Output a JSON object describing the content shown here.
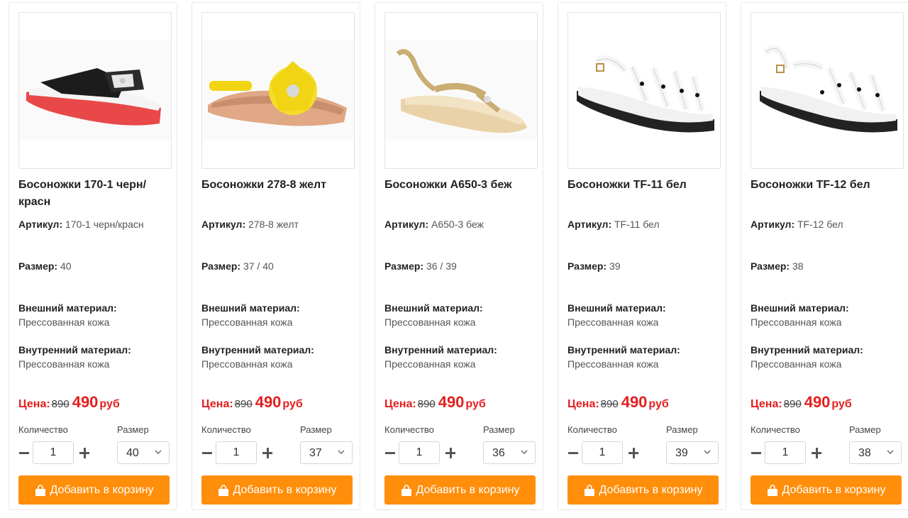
{
  "labels": {
    "article": "Артикул:",
    "size": "Размер:",
    "outer_material": "Внешний материал:",
    "inner_material": "Внутренний материал:",
    "price": "Цена:",
    "currency": "руб",
    "quantity": "Количество",
    "size_select": "Размер",
    "add_to_cart": "Добавить в корзину"
  },
  "colors": {
    "accent": "#ff8e0a",
    "price": "#e41e1e"
  },
  "products": [
    {
      "title": "Босоножки 170-1 черн/ красн",
      "article": "170-1 черн/красн",
      "sizes": "40",
      "outer_material": "Прессованная кожа",
      "inner_material": "Прессованная кожа",
      "old_price": "890",
      "new_price": "490",
      "quantity": "1",
      "selected_size": "40"
    },
    {
      "title": "Босоножки 278-8 желт",
      "article": "278-8 желт",
      "sizes": "37 / 40",
      "outer_material": "Прессованная кожа",
      "inner_material": "Прессованная кожа",
      "old_price": "890",
      "new_price": "490",
      "quantity": "1",
      "selected_size": "37"
    },
    {
      "title": "Босоножки A650-3 беж",
      "article": "A650-3 беж",
      "sizes": "36 / 39",
      "outer_material": "Прессованная кожа",
      "inner_material": "Прессованная кожа",
      "old_price": "890",
      "new_price": "490",
      "quantity": "1",
      "selected_size": "36"
    },
    {
      "title": "Босоножки TF-11 бел",
      "article": "TF-11 бел",
      "sizes": "39",
      "outer_material": "Прессованная кожа",
      "inner_material": "Прессованная кожа",
      "old_price": "890",
      "new_price": "490",
      "quantity": "1",
      "selected_size": "39"
    },
    {
      "title": "Босоножки TF-12 бел",
      "article": "TF-12 бел",
      "sizes": "38",
      "outer_material": "Прессованная кожа",
      "inner_material": "Прессованная кожа",
      "old_price": "890",
      "new_price": "490",
      "quantity": "1",
      "selected_size": "38"
    }
  ]
}
